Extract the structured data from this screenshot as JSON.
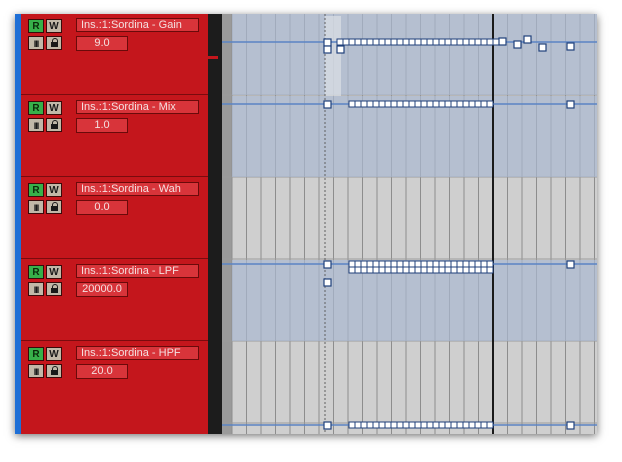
{
  "tracks": [
    {
      "record_label": "R",
      "write_label": "W",
      "edit_label": "III",
      "param": "Ins.:1:Sordina - Gain",
      "value": "9.0"
    },
    {
      "record_label": "R",
      "write_label": "W",
      "edit_label": "III",
      "param": "Ins.:1:Sordina - Mix",
      "value": "1.0"
    },
    {
      "record_label": "R",
      "write_label": "W",
      "edit_label": "III",
      "param": "Ins.:1:Sordina - Wah",
      "value": "0.0"
    },
    {
      "record_label": "R",
      "write_label": "W",
      "edit_label": "III",
      "param": "Ins.:1:Sordina - LPF",
      "value": "20000.0"
    },
    {
      "record_label": "R",
      "write_label": "W",
      "edit_label": "III",
      "param": "Ins.:1:Sordina - HPF",
      "value": "20.0"
    }
  ],
  "colors": {
    "track_panel": "#c4161c",
    "record_active": "#37b04a",
    "automation_line": "#5b84c4",
    "selection_overlay": "#a9b8d0",
    "playhead": "#1a1a1a"
  },
  "icons": {
    "lock": "lock-icon"
  }
}
